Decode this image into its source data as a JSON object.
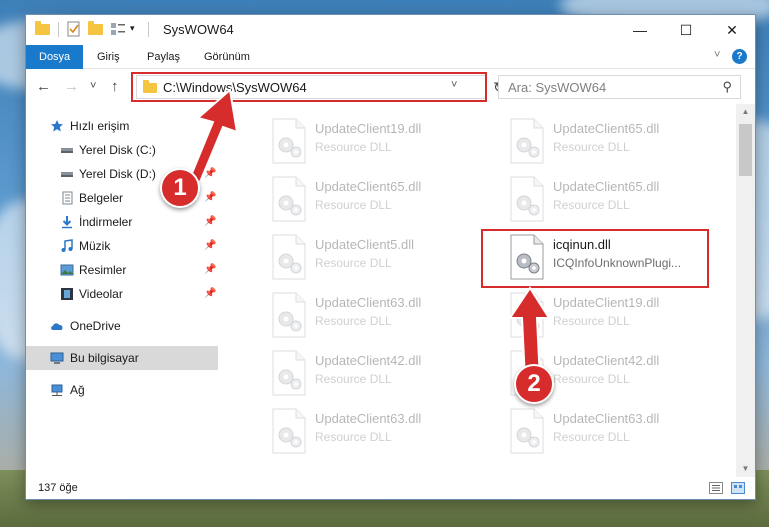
{
  "window": {
    "title": "SysWOW64"
  },
  "ribbon": {
    "tabs": [
      {
        "label": "Dosya",
        "active": true
      },
      {
        "label": "Giriş",
        "active": false
      },
      {
        "label": "Paylaş",
        "active": false
      },
      {
        "label": "Görünüm",
        "active": false
      }
    ],
    "help": "?"
  },
  "window_controls": {
    "minimize": "—",
    "maximize": "☐",
    "close": "✕"
  },
  "navigation": {
    "back": "←",
    "forward": "→",
    "recent": "˅",
    "up": "↑",
    "address": "C:\\Windows\\SysWOW64",
    "search_placeholder": "Ara: SysWOW64"
  },
  "sidebar": {
    "items": [
      {
        "label": "Hızlı erişim",
        "icon": "star-icon"
      },
      {
        "label": "Yerel Disk (C:)",
        "icon": "drive-icon",
        "pinned": true
      },
      {
        "label": "Yerel Disk (D:)",
        "icon": "drive-icon",
        "pinned": true
      },
      {
        "label": "Belgeler",
        "icon": "documents-icon",
        "pinned": true
      },
      {
        "label": "İndirmeler",
        "icon": "downloads-icon",
        "pinned": true
      },
      {
        "label": "Müzik",
        "icon": "music-icon",
        "pinned": true
      },
      {
        "label": "Resimler",
        "icon": "pictures-icon",
        "pinned": true
      },
      {
        "label": "Videolar",
        "icon": "videos-icon",
        "pinned": true
      },
      {
        "label": "OneDrive",
        "icon": "cloud-icon"
      },
      {
        "label": "Bu bilgisayar",
        "icon": "computer-icon",
        "selected": true
      },
      {
        "label": "Ağ",
        "icon": "network-icon"
      }
    ]
  },
  "files": {
    "left": [
      {
        "name": "UpdateClient19.dll",
        "type": "Resource DLL"
      },
      {
        "name": "UpdateClient65.dll",
        "type": "Resource DLL"
      },
      {
        "name": "UpdateClient5.dll",
        "type": "Resource DLL"
      },
      {
        "name": "UpdateClient63.dll",
        "type": "Resource DLL"
      },
      {
        "name": "UpdateClient42.dll",
        "type": "Resource DLL"
      },
      {
        "name": "UpdateClient63.dll",
        "type": "Resource DLL"
      }
    ],
    "right": [
      {
        "name": "UpdateClient65.dll",
        "type": "Resource DLL"
      },
      {
        "name": "UpdateClient65.dll",
        "type": "Resource DLL"
      },
      {
        "name": "icqinun.dll",
        "type": "ICQInfoUnknownPlugi...",
        "highlighted": true
      },
      {
        "name": "UpdateClient19.dll",
        "type": "Resource DLL"
      },
      {
        "name": "UpdateClient42.dll",
        "type": "Resource DLL"
      },
      {
        "name": "UpdateClient63.dll",
        "type": "Resource DLL"
      }
    ]
  },
  "status": {
    "item_count": "137 öğe"
  },
  "annotations": {
    "callout_1": "1",
    "callout_2": "2",
    "color": "#d72c2c"
  },
  "colors": {
    "accent": "#1979ca",
    "highlight": "#d72c2c",
    "selected_nav": "#d9d9d9"
  }
}
